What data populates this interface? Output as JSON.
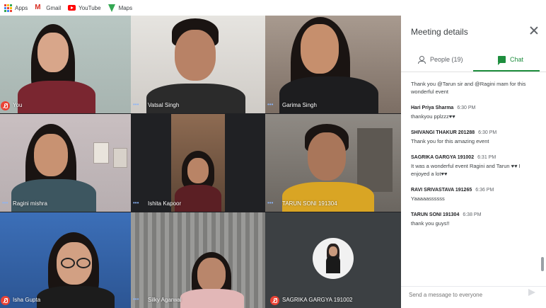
{
  "bookmarks": [
    {
      "label": "Apps",
      "icon": "apps-icon"
    },
    {
      "label": "Gmail",
      "icon": "gmail-icon"
    },
    {
      "label": "YouTube",
      "icon": "youtube-icon"
    },
    {
      "label": "Maps",
      "icon": "maps-icon"
    }
  ],
  "participants": [
    {
      "name": "You",
      "muted": true
    },
    {
      "name": "Vatsal Singh",
      "muted": false
    },
    {
      "name": "Garima Singh",
      "muted": false
    },
    {
      "name": "Ragini mishra",
      "muted": false
    },
    {
      "name": "Ishita Kapoor",
      "muted": false
    },
    {
      "name": "TARUN SONI 191304",
      "muted": false
    },
    {
      "name": "Isha Gupta",
      "muted": true
    },
    {
      "name": "Silky Agarwal",
      "muted": false
    },
    {
      "name": "SAGRIKA GARGYA 191002",
      "muted": true
    }
  ],
  "panel": {
    "title": "Meeting details",
    "tabs": {
      "people": "People (19)",
      "chat": "Chat"
    },
    "composer_placeholder": "Send a message to everyone"
  },
  "messages": [
    {
      "sender": "",
      "time": "",
      "text": "Thank you @Tarun sir  and @Ragini mam for this wonderful event"
    },
    {
      "sender": "Hari Priya Sharma",
      "time": "6:30 PM",
      "text": "thankyou pplzzz♥♥"
    },
    {
      "sender": "SHIVANGI THAKUR 201288",
      "time": "6:30 PM",
      "text": "Thank you for this amazing event"
    },
    {
      "sender": "SAGRIKA GARGYA 191002",
      "time": "6:31 PM",
      "text": "It was a wonderful event Ragini and Tarun ♥♥ I enjoyed a lot♥♥"
    },
    {
      "sender": "RAVI SRIVASTAVA 191265",
      "time": "6:36 PM",
      "text": "Yaaaaassssss"
    },
    {
      "sender": "TARUN SONI 191304",
      "time": "6:38 PM",
      "text": "thank you guys!!"
    }
  ],
  "colors": {
    "accent_green": "#1e8e3e",
    "mute_red": "#ea4335",
    "speaking_blue": "#8ab4f8"
  }
}
